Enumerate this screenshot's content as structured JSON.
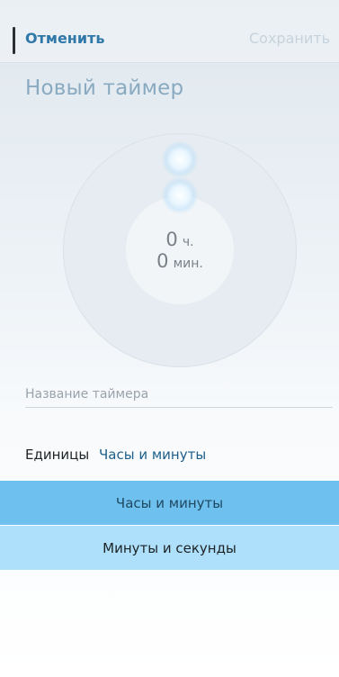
{
  "header": {
    "cancel_label": "Отменить",
    "save_label": "Сохранить"
  },
  "title": "Новый таймер",
  "dial": {
    "hours_value": "0",
    "hours_unit": "ч.",
    "minutes_value": "0",
    "minutes_unit": "мин."
  },
  "name_field": {
    "value": "",
    "placeholder": "Название таймера"
  },
  "units": {
    "label": "Единицы",
    "selected": "Часы и минуты",
    "options": [
      {
        "label": "Часы и минуты",
        "selected": true
      },
      {
        "label": "Минуты и секунды",
        "selected": false
      }
    ]
  },
  "colors": {
    "accent": "#2f78a8",
    "selected_option_bg": "#6ec1ee",
    "option_bg": "#aee0fb",
    "disabled_text": "#c6d3dd"
  }
}
